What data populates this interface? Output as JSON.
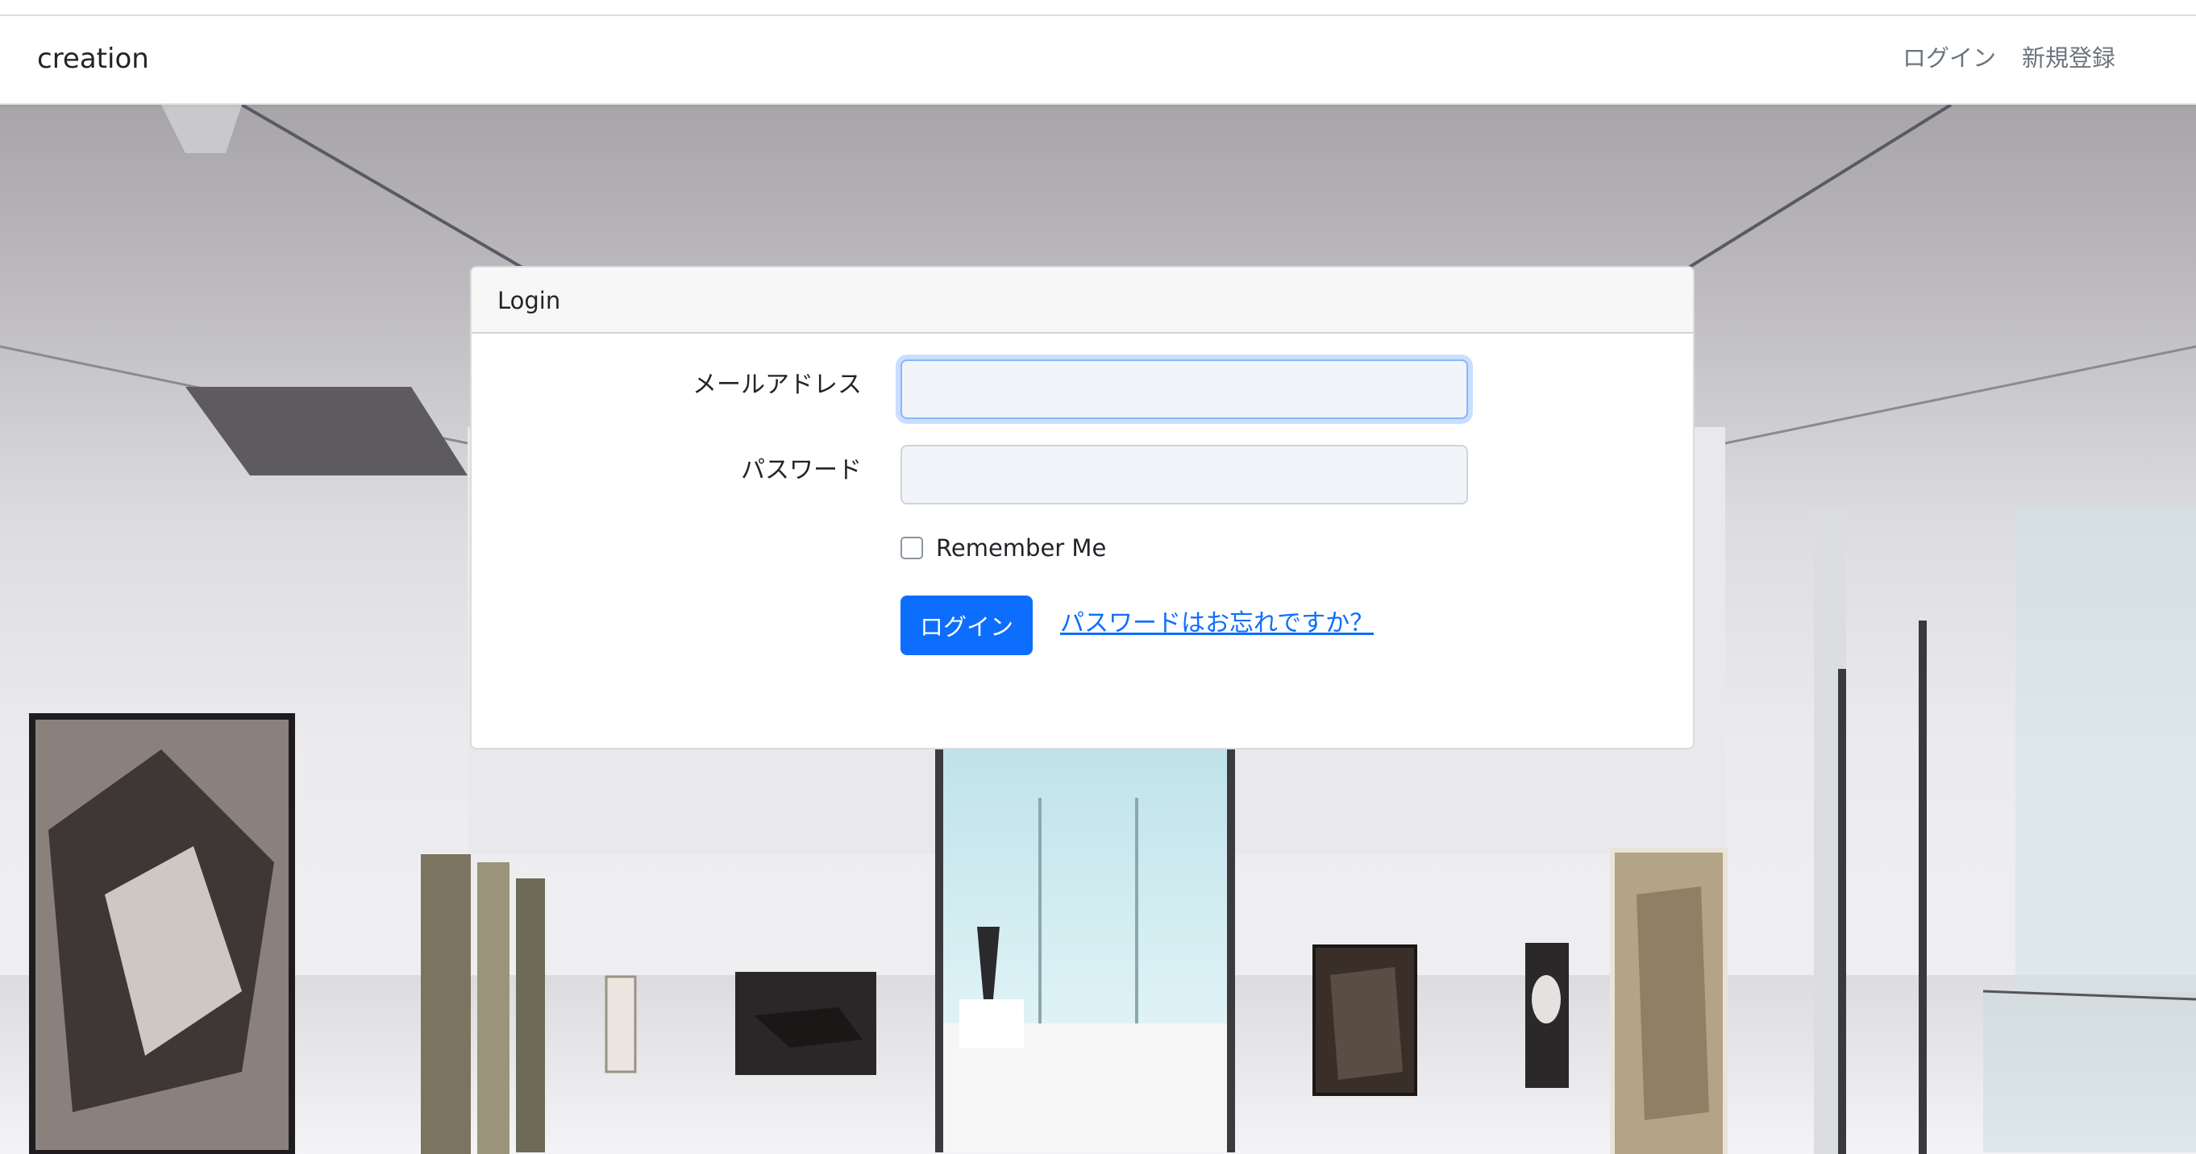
{
  "navbar": {
    "brand": "creation",
    "links": [
      {
        "label": "ログイン"
      },
      {
        "label": "新規登録"
      }
    ]
  },
  "login_card": {
    "header": "Login",
    "email_label": "メールアドレス",
    "email_value": "",
    "password_label": "パスワード",
    "password_value": "",
    "remember_label": "Remember Me",
    "remember_checked": false,
    "submit_label": "ログイン",
    "forgot_link": "パスワードはお忘れですか？"
  },
  "colors": {
    "primary": "#0d6efd",
    "nav_text": "#6c757d",
    "card_header_bg": "#f7f7f7"
  }
}
